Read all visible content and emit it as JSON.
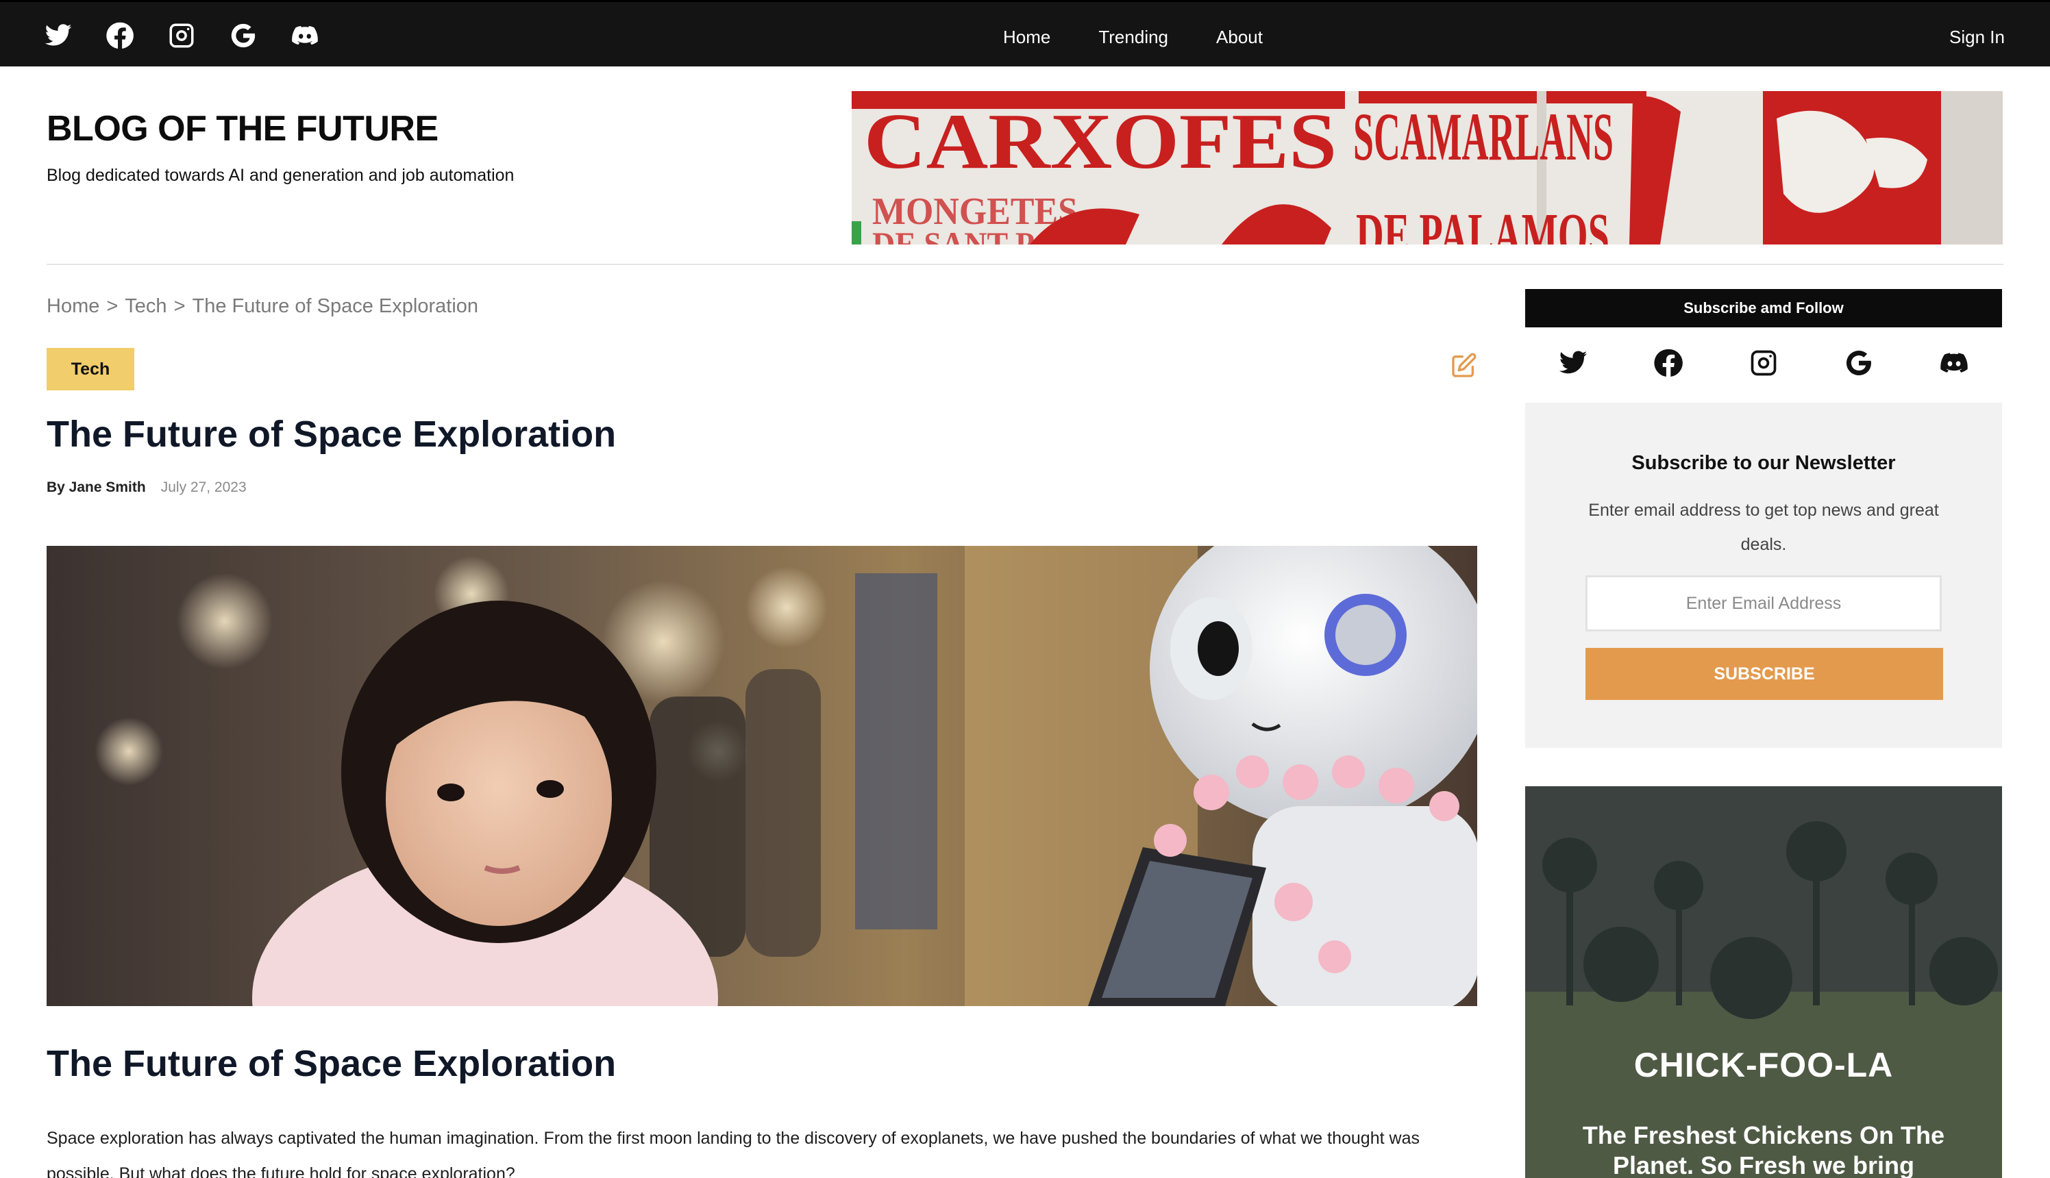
{
  "nav": {
    "social_icons": [
      "twitter-icon",
      "facebook-icon",
      "instagram-icon",
      "google-icon",
      "discord-icon"
    ],
    "links": [
      "Home",
      "Trending",
      "About"
    ],
    "sign_in": "Sign In"
  },
  "header": {
    "title": "BLOG OF THE FUTURE",
    "tagline": "Blog dedicated towards AI and generation and job automation",
    "banner_words": [
      "CARXOFES",
      "SCAMARLANS",
      "MONGETES",
      "DE SANT PAU",
      "DE PALAMOS"
    ]
  },
  "breadcrumb": {
    "items": [
      "Home",
      "Tech",
      "The Future of Space Exploration"
    ],
    "separator": ">"
  },
  "article": {
    "category": "Tech",
    "title": "The Future of Space Exploration",
    "author": "By Jane Smith",
    "date": "July 27, 2023",
    "section_title": "The Future of Space Exploration",
    "body": "Space exploration has always captivated the human imagination. From the first moon landing to the discovery of exoplanets, we have pushed the boundaries of what we thought was possible. But what does the future hold for space exploration?"
  },
  "sidebar": {
    "follow_heading": "Subscribe amd Follow",
    "follow_icons": [
      "twitter-icon",
      "facebook-icon",
      "instagram-icon",
      "google-icon",
      "discord-icon"
    ],
    "newsletter": {
      "title": "Subscribe to our Newsletter",
      "description": "Enter email address to get top news and great deals.",
      "email_placeholder": "Enter Email Address",
      "button": "SUBSCRIBE"
    },
    "ad": {
      "title": "CHICK-FOO-LA",
      "subtitle": "The Freshest Chickens On The Planet. So Fresh we bring"
    }
  },
  "colors": {
    "nav_bg": "#141414",
    "badge": "#f1cd6c",
    "subscribe_button": "#e49a4d",
    "edit_icon": "#e49a4d",
    "newsletter_bg": "#f2f2f2"
  }
}
